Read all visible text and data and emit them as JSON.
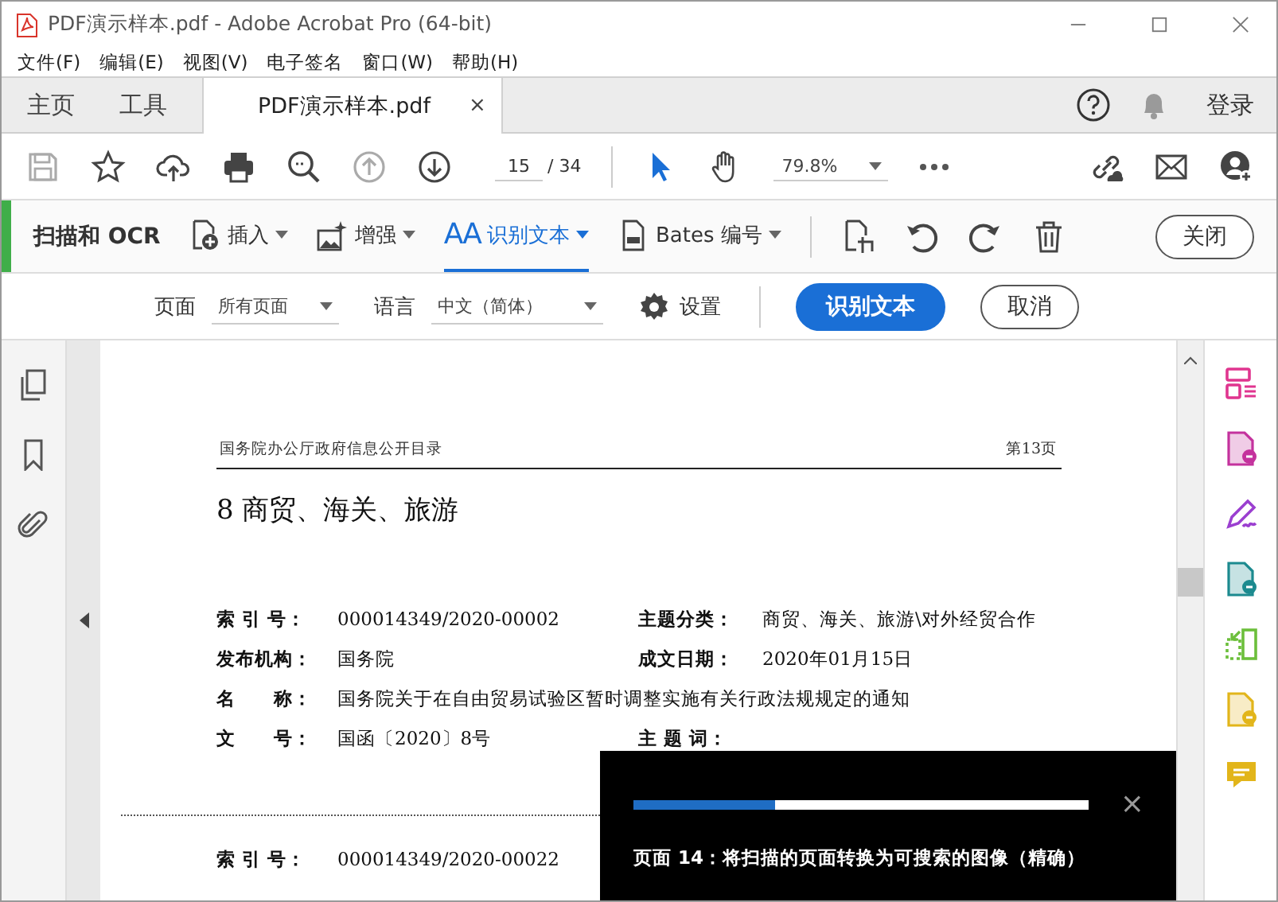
{
  "window": {
    "title": "PDF演示样本.pdf - Adobe Acrobat Pro (64-bit)"
  },
  "menu": [
    "文件(F)",
    "编辑(E)",
    "视图(V)",
    "电子签名",
    "窗口(W)",
    "帮助(H)"
  ],
  "tabs": [
    {
      "label": "主页",
      "selected": false
    },
    {
      "label": "工具",
      "selected": false
    },
    {
      "label": "PDF演示样本.pdf",
      "selected": true,
      "close": "×"
    }
  ],
  "sign_in": "登录",
  "toolbar": {
    "page_number": "15",
    "page_total": "/ 34",
    "zoom": "79.8%"
  },
  "ocr_toolbar": {
    "title": "扫描和 OCR",
    "close": "关闭",
    "tools": [
      {
        "kind": "insert",
        "label": "插入",
        "selected": false
      },
      {
        "kind": "enhance",
        "label": "增强",
        "selected": false
      },
      {
        "kind": "recognize",
        "glyph": "AA",
        "label": "识别文本",
        "selected": true
      },
      {
        "kind": "bates",
        "label": "Bates 编号",
        "selected": false
      }
    ]
  },
  "options": {
    "page_label": "页面",
    "page_value": "所有页面",
    "language_label": "语言",
    "language_value": "中文（简体）",
    "settings": "设置",
    "recognize": "识别文本",
    "cancel": "取消"
  },
  "document": {
    "header_left": "国务院办公厅政府信息公开目录",
    "header_right": "第13页",
    "heading": "8  商贸、海关、旅游",
    "records": [
      {
        "rows": [
          {
            "label": "索 引 号：",
            "value": "000014349/2020-00002",
            "label2": "主题分类：",
            "value2": "商贸、海关、旅游\\对外经贸合作"
          },
          {
            "label": "发布机构：",
            "value": "国务院",
            "label2": "成文日期：",
            "value2": "2020年01月15日"
          },
          {
            "label": "名　　称：",
            "value": "国务院关于在自由贸易试验区暂时调整实施有关行政法规规定的通知"
          },
          {
            "label": "文　　号：",
            "value": "国函〔2020〕8号",
            "label2": "主 题 词："
          }
        ]
      },
      {
        "rows": [
          {
            "label": "索 引 号：",
            "value": "000014349/2020-00022"
          }
        ]
      }
    ]
  },
  "progress_toast": {
    "level": 0.31,
    "message": "页面 14：将扫描的页面转换为可搜索的图像（精确）",
    "close": "×"
  }
}
